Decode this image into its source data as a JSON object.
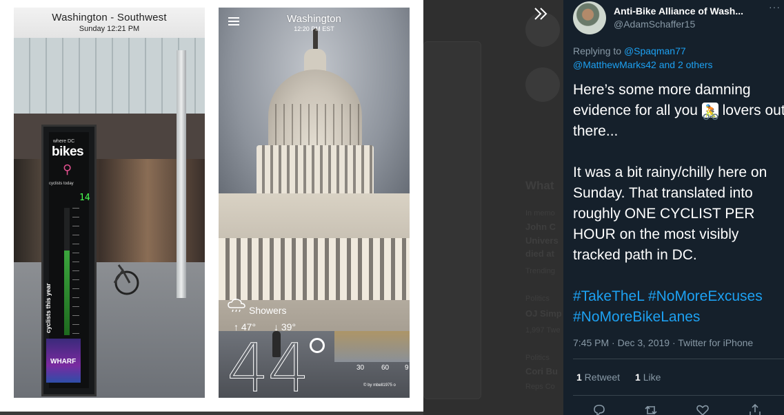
{
  "photo1": {
    "location": "Washington - Southwest",
    "datetime": "Sunday  12:21 PM",
    "counter": {
      "brand_small": "where DC",
      "brand_big": "bikes",
      "today_label": "cyclists today",
      "today_count": "14",
      "year_label": "cyclists this year",
      "sponsor": "WHARF"
    }
  },
  "photo2": {
    "city": "Washington",
    "time": "12:20 PM EST",
    "condition": "Showers",
    "high": "↑ 47°",
    "low": "↓ 39°",
    "temperature": "44",
    "axis": [
      "30",
      "60",
      "9"
    ],
    "credit": "© by mbell1975 o"
  },
  "tweet": {
    "display_name": "Anti-Bike Alliance of Wash...",
    "handle": "@AdamSchaffer15",
    "more_label": "···",
    "replying_prefix": "Replying to ",
    "replying_to_1": "@Spaqman77",
    "replying_to_2": "@MatthewMarks42 and 2 others",
    "text_line_1a": "Here’s some more damning evidence for all you ",
    "text_line_1b": " lovers out there...",
    "emoji": "🚴",
    "text_para_2": "It was a bit rainy/chilly here on Sunday. That translated into roughly ONE CYCLIST PER HOUR on the most visibly tracked path in DC.",
    "hashtags": "#TakeTheL #NoMoreExcuses #NoMoreBikeLanes",
    "timestamp": "7:45 PM · Dec 3, 2019 · Twitter for iPhone",
    "retweet_count": "1",
    "retweet_label": " Retweet",
    "like_count": "1",
    "like_label": " Like",
    "icons": [
      "reply-icon",
      "retweet-icon",
      "like-icon",
      "share-icon"
    ]
  },
  "background": {
    "heading": "What",
    "items": [
      "In memo",
      "John C",
      "Univers",
      "died at",
      "Trending",
      "Politics",
      "OJ Simp",
      "1,997 Twe",
      "Politics",
      "Cori Bu",
      "Reps Co"
    ]
  },
  "colors": {
    "panel_bg": "#15202b",
    "link": "#1da1f2",
    "muted": "#8899a6"
  }
}
